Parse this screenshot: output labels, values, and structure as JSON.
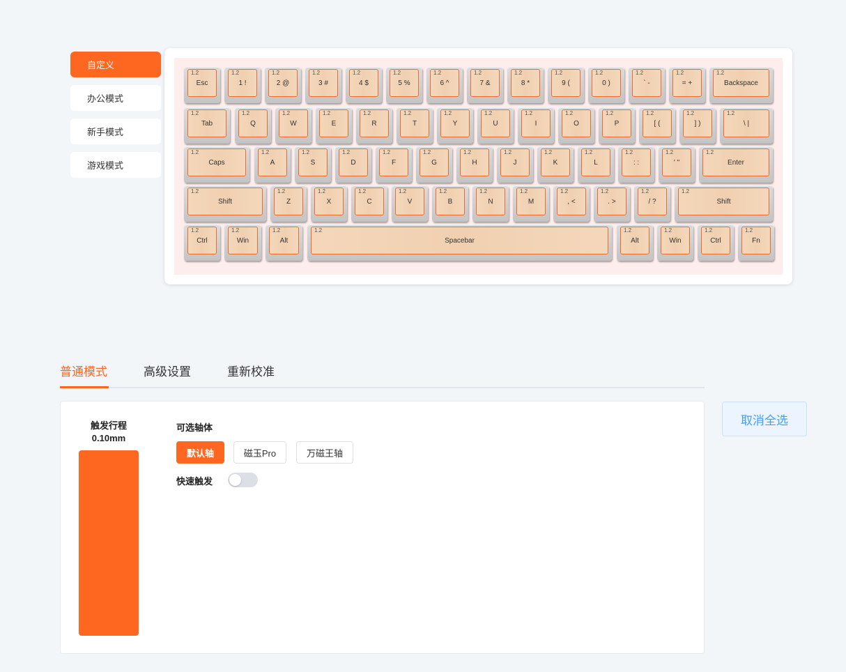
{
  "modes": {
    "items": [
      {
        "label": "自定义",
        "active": true
      },
      {
        "label": "办公模式",
        "active": false
      },
      {
        "label": "新手模式",
        "active": false
      },
      {
        "label": "游戏模式",
        "active": false
      }
    ]
  },
  "keyboard": {
    "default_actuation": "1.2",
    "rows": [
      [
        "Esc",
        "1 !",
        "2 @",
        "3 #",
        "4 $",
        "5 %",
        "6 ^",
        "7 &",
        "8 *",
        "9 (",
        "0 )",
        "` -",
        "= +",
        "Backspace"
      ],
      [
        "Tab",
        "Q",
        "W",
        "E",
        "R",
        "T",
        "Y",
        "U",
        "I",
        "O",
        "P",
        "[ (",
        "] )",
        "\\ |"
      ],
      [
        "Caps",
        "A",
        "S",
        "D",
        "F",
        "G",
        "H",
        "J",
        "K",
        "L",
        ": :",
        "' \"",
        "Enter"
      ],
      [
        "Shift",
        "Z",
        "X",
        "C",
        "V",
        "B",
        "N",
        "M",
        ", <",
        ". >",
        "/ ?",
        "Shift"
      ],
      [
        "Ctrl",
        "Win",
        "Alt",
        "Spacebar",
        "Alt",
        "Win",
        "Ctrl",
        "Fn"
      ]
    ]
  },
  "tabs": [
    {
      "label": "普通模式",
      "active": true
    },
    {
      "label": "高级设置",
      "active": false
    },
    {
      "label": "重新校准",
      "active": false
    }
  ],
  "panel": {
    "travel_title": "触发行程",
    "travel_value": "0.10mm",
    "switch_title": "可选轴体",
    "switches": [
      {
        "label": "默认轴",
        "active": true
      },
      {
        "label": "磁玉Pro",
        "active": false
      },
      {
        "label": "万磁王轴",
        "active": false
      }
    ],
    "rapid_trigger_label": "快速触发",
    "rapid_trigger_on": false
  },
  "deselect_label": "取消全选",
  "colors": {
    "accent": "#fd6720",
    "key_border": "#f06a2a",
    "keycap": "#f2d3b5",
    "deselect_text": "#409eff"
  }
}
